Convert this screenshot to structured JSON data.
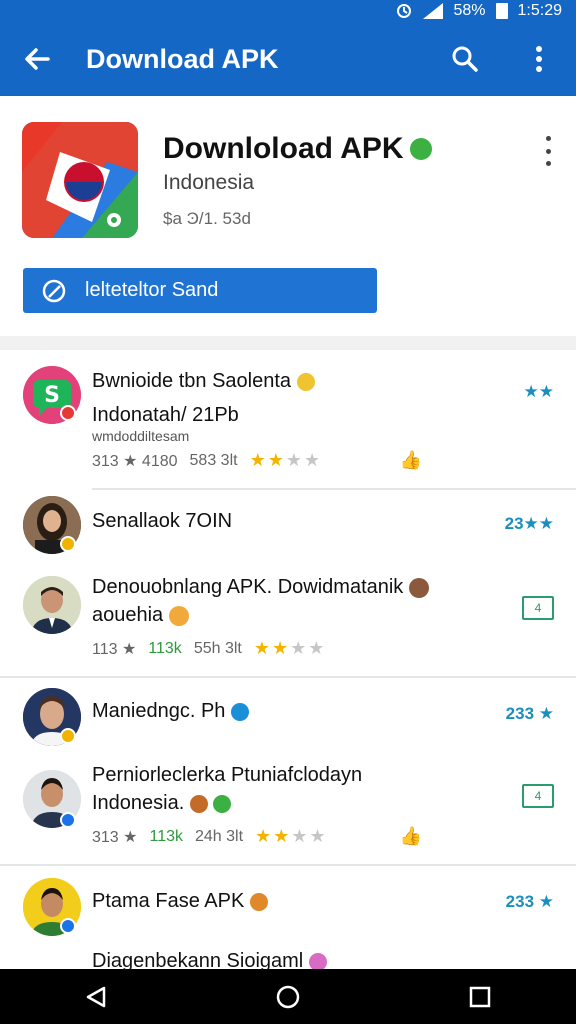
{
  "status_bar": {
    "battery": "58%",
    "time": "1:5:29"
  },
  "app_bar": {
    "title": "Download APK"
  },
  "hero": {
    "app_name": "Downloload APK",
    "country": "Indonesia",
    "meta": "$a Ͽ/1. 53d",
    "button_label": "lelteteltor Sand"
  },
  "items": [
    {
      "title": "Bwnioide  tbn Saolenta",
      "subtitle": "Indonatah/ 21Pb",
      "url": "wmdoddiltesam",
      "stats_a": "313 ★ 4180",
      "stats_b": "583 3lt",
      "stars": 2,
      "right": "★★"
    },
    {
      "title": "Senallaok 7OIN",
      "right": "23★★"
    },
    {
      "title": "Denouobnlang APK. Dowidmatanik",
      "subtitle": "aouehia",
      "stats_a": "113 ★",
      "stats_green": "113k",
      "stats_b": "55h 3lt",
      "stars": 2,
      "box": "4"
    },
    {
      "title": "Maniedngc. Ph",
      "right": "233 ★"
    },
    {
      "title": "Perniorleclerka Ptuniafclodayn",
      "subtitle": "Indonesia.",
      "stats_a": "313 ★",
      "stats_green": "113k",
      "stats_b": "24h 3lt",
      "stars": 2,
      "box": "4"
    },
    {
      "title": "Ptama Fase APK",
      "right": "233 ★"
    },
    {
      "title": "Diagenbekann Sioigaml"
    }
  ],
  "colors": {
    "primary": "#1567c6",
    "button": "#1f73d2",
    "star": "#f2b400",
    "teal": "#1a8fbf"
  }
}
